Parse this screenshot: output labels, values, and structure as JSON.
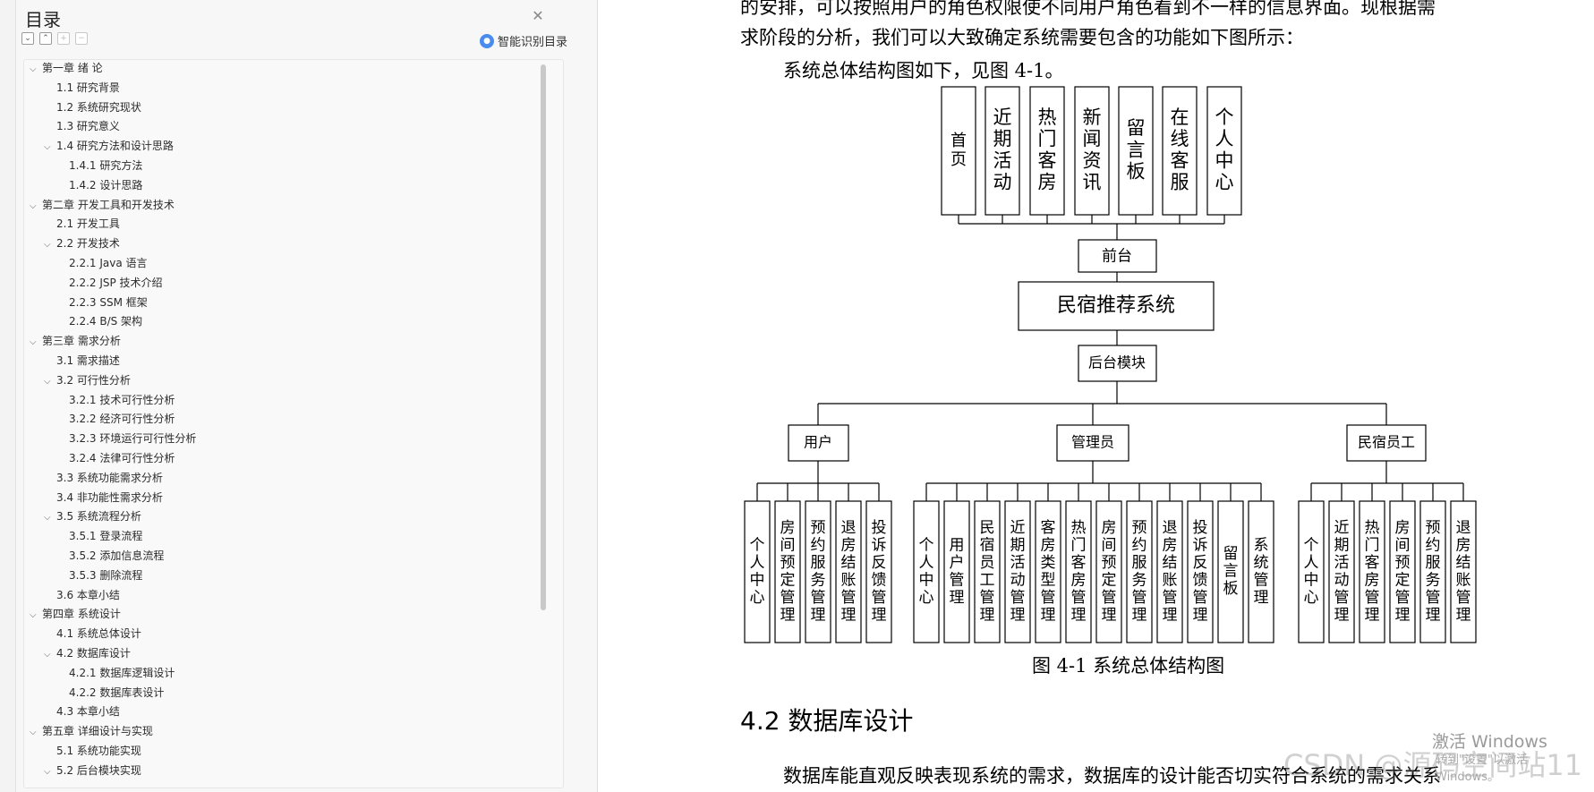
{
  "sidebar": {
    "title": "目录",
    "close_icon": "close-icon",
    "smart_toc_label": "智能识别目录",
    "toc": [
      {
        "label": "第一章  绪   论",
        "level": 0,
        "collapsible": true
      },
      {
        "label": "1.1 研究背景",
        "level": 1,
        "collapsible": false
      },
      {
        "label": "1.2 系统研究现状",
        "level": 1,
        "collapsible": false
      },
      {
        "label": "1.3  研究意义",
        "level": 1,
        "collapsible": false
      },
      {
        "label": "1.4  研究方法和设计思路",
        "level": 1,
        "collapsible": true
      },
      {
        "label": "1.4.1 研究方法",
        "level": 2,
        "collapsible": false
      },
      {
        "label": "1.4.2 设计思路",
        "level": 2,
        "collapsible": false
      },
      {
        "label": "第二章  开发工具和开发技术",
        "level": 0,
        "collapsible": true
      },
      {
        "label": "2.1 开发工具",
        "level": 1,
        "collapsible": false
      },
      {
        "label": "2.2  开发技术",
        "level": 1,
        "collapsible": true
      },
      {
        "label": "2.2.1 Java 语言",
        "level": 2,
        "collapsible": false
      },
      {
        "label": "2.2.2 JSP 技术介绍",
        "level": 2,
        "collapsible": false
      },
      {
        "label": "2.2.3 SSM 框架",
        "level": 2,
        "collapsible": false
      },
      {
        "label": "2.2.4 B/S 架构",
        "level": 2,
        "collapsible": false
      },
      {
        "label": "第三章  需求分析",
        "level": 0,
        "collapsible": true
      },
      {
        "label": "3.1  需求描述",
        "level": 1,
        "collapsible": false
      },
      {
        "label": "3.2 可行性分析",
        "level": 1,
        "collapsible": true
      },
      {
        "label": "3.2.1 技术可行性分析",
        "level": 2,
        "collapsible": false
      },
      {
        "label": "3.2.2  经济可行性分析",
        "level": 2,
        "collapsible": false
      },
      {
        "label": "3.2.3  环境运行可行性分析",
        "level": 2,
        "collapsible": false
      },
      {
        "label": "3.2.4  法律可行性分析",
        "level": 2,
        "collapsible": false
      },
      {
        "label": "3.3  系统功能需求分析",
        "level": 1,
        "collapsible": false
      },
      {
        "label": "3.4  非功能性需求分析",
        "level": 1,
        "collapsible": false
      },
      {
        "label": "3.5  系统流程分析",
        "level": 1,
        "collapsible": true
      },
      {
        "label": "3.5.1  登录流程",
        "level": 2,
        "collapsible": false
      },
      {
        "label": "3.5.2  添加信息流程",
        "level": 2,
        "collapsible": false
      },
      {
        "label": "3.5.3  删除流程",
        "level": 2,
        "collapsible": false
      },
      {
        "label": "3.6  本章小结",
        "level": 1,
        "collapsible": false
      },
      {
        "label": "第四章  系统设计",
        "level": 0,
        "collapsible": true
      },
      {
        "label": "4.1  系统总体设计",
        "level": 1,
        "collapsible": false
      },
      {
        "label": "4.2  数据库设计",
        "level": 1,
        "collapsible": true
      },
      {
        "label": "4.2.1  数据库逻辑设计",
        "level": 2,
        "collapsible": false
      },
      {
        "label": "4.2.2  数据库表设计",
        "level": 2,
        "collapsible": false
      },
      {
        "label": "4.3  本章小结",
        "level": 1,
        "collapsible": false
      },
      {
        "label": "第五章  详细设计与实现",
        "level": 0,
        "collapsible": true
      },
      {
        "label": "5.1 系统功能实现",
        "level": 1,
        "collapsible": false
      },
      {
        "label": "5.2 后台模块实现",
        "level": 1,
        "collapsible": true
      }
    ]
  },
  "document": {
    "line_top": "的安排，可以按照用户的角色权限使不同用户角色看到不一样的信息界面。现根据需",
    "line_two": "求阶段的分析，我们可以大致确定系统需要包含的功能如下图所示：",
    "line_three": "系统总体结构图如下，见图 4-1。",
    "caption": "图 4-1  系统总体结构图",
    "heading": "4.2  数据库设计",
    "line_last": "数据库能直观反映表现系统的需求，数据库的设计能否切实符合系统的需求关系"
  },
  "diagram": {
    "front_modules": [
      "首页",
      "近期活动",
      "热门客房",
      "新闻资讯",
      "留言板",
      "在线客服",
      "个人中心"
    ],
    "front_node": "前台",
    "system_node": "民宿推荐系统",
    "back_node": "后台模块",
    "roles": [
      {
        "name": "用户",
        "modules": [
          "个人中心",
          "房间预定管理",
          "预约服务管理",
          "退房结账管理",
          "投诉反馈管理"
        ]
      },
      {
        "name": "管理员",
        "modules": [
          "个人中心",
          "用户管理",
          "民宿员工管理",
          "近期活动管理",
          "客房类型管理",
          "热门客房管理",
          "房间预定管理",
          "预约服务管理",
          "退房结账管理",
          "投诉反馈管理",
          "留言板",
          "系统管理"
        ]
      },
      {
        "name": "民宿员工",
        "modules": [
          "个人中心",
          "近期活动管理",
          "热门客房管理",
          "房间预定管理",
          "预约服务管理",
          "退房结账管理"
        ]
      }
    ]
  },
  "overlay": {
    "windows_line1": "激活 Windows",
    "windows_line2": "转到\"设置\"以激活 Windows。",
    "csdn_mark": "CSDN @源码空间站11"
  }
}
